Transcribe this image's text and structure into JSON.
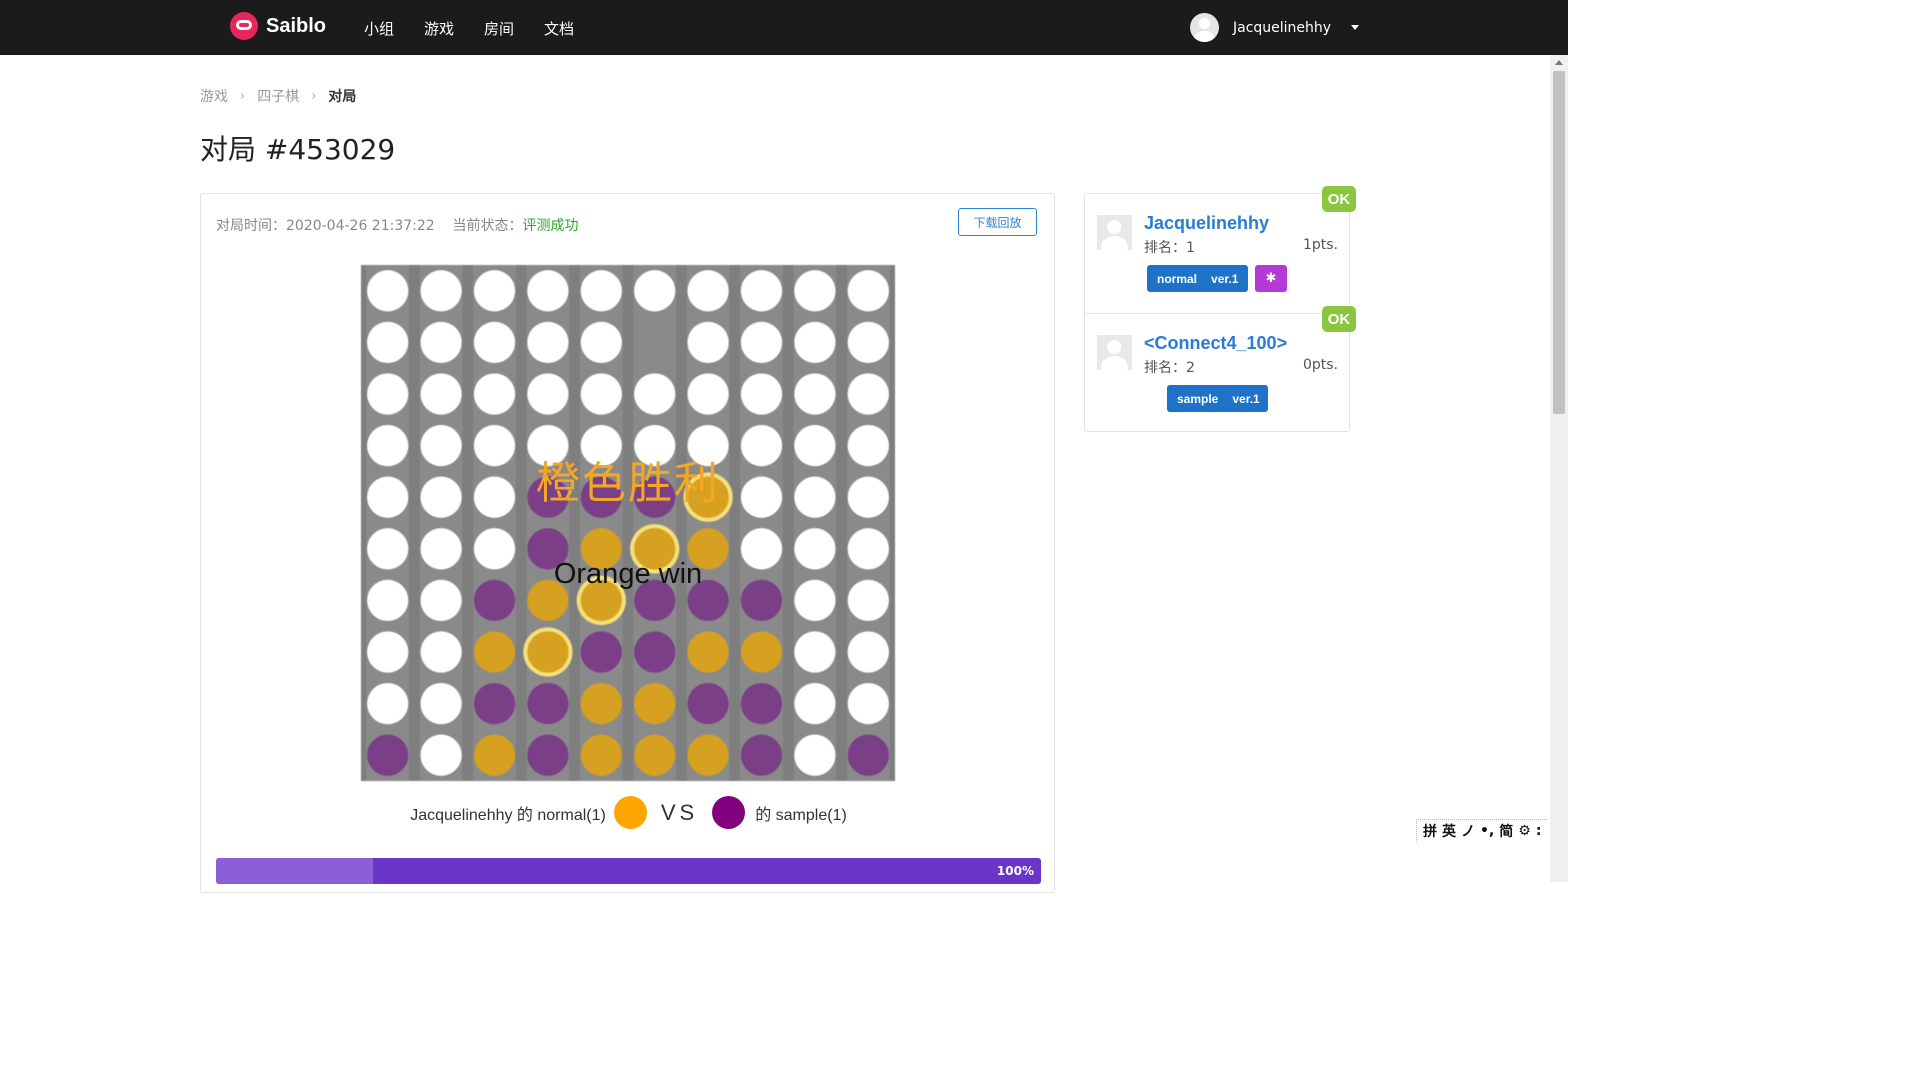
{
  "navbar": {
    "brand": "Saiblo",
    "links": [
      "小组",
      "游戏",
      "房间",
      "文档"
    ],
    "user": "Jacquelinehhy"
  },
  "breadcrumb": [
    "游戏",
    "四子棋",
    "对局"
  ],
  "page_title": "对局 #453029",
  "match": {
    "time_label": "对局时间：",
    "time": "2020-04-26 21:37:22",
    "status_label": "当前状态：",
    "status": "评测成功",
    "download_label": "下载回放"
  },
  "board": {
    "rows": 10,
    "cols": 10,
    "colors": {
      "board": "#7e7e7e",
      "empty": "#ffffff",
      "orange": "#d6a021",
      "purple": "#7a3f86",
      "highlight": "#f3e07a"
    },
    "grid": [
      "EEEEEEEEEE",
      "EEEEEXEEEE",
      "EEEEEEEEEE",
      "EEEEEEEEEE",
      "EEEPPPOEEE",
      "EEEPOOOEEE",
      "EEPOOPPPEE",
      "EEOOPPOOEE",
      "EEPPOOPPEE",
      "PEOPOOOPEP"
    ],
    "winning_cells": [
      [
        7,
        3
      ],
      [
        6,
        4
      ],
      [
        5,
        5
      ],
      [
        4,
        6
      ]
    ],
    "overlay_cn": "橙色胜利",
    "overlay_en": "Orange win"
  },
  "versus": {
    "left": "Jacquelinehhy 的 normal(1)",
    "left_color": "#ffa500",
    "vs": "VS",
    "right_color": "#800080",
    "right": "的 sample(1)"
  },
  "progress": {
    "loaded": 0.19,
    "percent_label": "100%",
    "colors": {
      "track": "#6a35c9",
      "segment": "#8a5fd8"
    }
  },
  "players": [
    {
      "name": "Jacquelinehhy",
      "rank": "排名：1",
      "points": "1pts.",
      "status": "OK",
      "tag": "normal",
      "version": "ver.1",
      "bug_icon": "bug-icon"
    },
    {
      "name": "<Connect4_100>",
      "rank": "排名：2",
      "points": "0pts.",
      "status": "OK",
      "tag": "sample",
      "version": "ver.1"
    }
  ],
  "ime": [
    "拼",
    "英",
    "ノ",
    "•,",
    "简",
    "⚙",
    ":"
  ]
}
